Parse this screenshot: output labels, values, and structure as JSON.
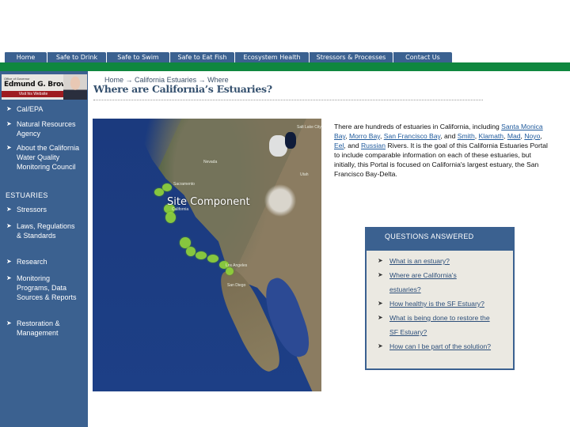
{
  "nav": {
    "tabs": [
      {
        "label": "Home"
      },
      {
        "label": "Safe to Drink"
      },
      {
        "label": "Safe to Swim"
      },
      {
        "label": "Safe to Eat Fish"
      },
      {
        "label": "Ecosystem Health"
      },
      {
        "label": "Stressors & Processes"
      },
      {
        "label": "Contact Us"
      }
    ]
  },
  "governor_banner": {
    "office": "Office of Governor",
    "name": "Edmund G. Brown Jr.",
    "link": "Visit his Website"
  },
  "sidebar": {
    "items_top": [
      {
        "label": "Cal/EPA"
      },
      {
        "label": "Natural Resources Agency"
      },
      {
        "label": "About the California Water Quality Monitoring Council"
      }
    ],
    "section_heading": "ESTUARIES",
    "items_estuaries": [
      {
        "label": "Stressors"
      },
      {
        "label": "Laws, Regulations & Standards"
      },
      {
        "label": "Research"
      },
      {
        "label": "Monitoring Programs, Data Sources & Reports"
      },
      {
        "label": "Restoration & Management"
      }
    ],
    "bullet_glyph": "➤"
  },
  "breadcrumb": {
    "items": [
      "Home",
      "California Estuaries",
      "Where"
    ],
    "separator": "→"
  },
  "page_title": "Where are California’s Estuaries?",
  "map": {
    "overlay_label": "Site Component",
    "place_labels": [
      "Nevada",
      "Utah",
      "California",
      "Sacramento",
      "Los Angeles",
      "San Diego",
      "Salt Lake City"
    ]
  },
  "intro": {
    "text_before": "There are hundreds of estuaries in California, including ",
    "links": [
      "Santa Monica Bay",
      "Morro Bay",
      "San Francisco Bay",
      "Smith",
      "Klamath",
      "Mad",
      "Noyo",
      "Eel",
      "Russian"
    ],
    "text_after": " Rivers.  It is the goal of this California Estuaries Portal to include comparable information on each of these estuaries, but initially, this Portal is focused on California's largest estuary, the San Francisco Bay-Delta.",
    "and": "and"
  },
  "questions": {
    "heading": "QUESTIONS ANSWERED",
    "items": [
      {
        "label": "What is an estuary?"
      },
      {
        "label": "Where are California's estuaries?"
      },
      {
        "label": "How healthy is the SF Estuary?"
      },
      {
        "label": "What is being done to restore the SF Estuary?"
      },
      {
        "label": "How can I be part of the solution?"
      }
    ]
  },
  "colors": {
    "nav_blue": "#3b6190",
    "green_bar": "#0f873f",
    "title_blue": "#34506e",
    "link_blue": "#1f5a9c",
    "qa_bg": "#ebe9e2"
  }
}
